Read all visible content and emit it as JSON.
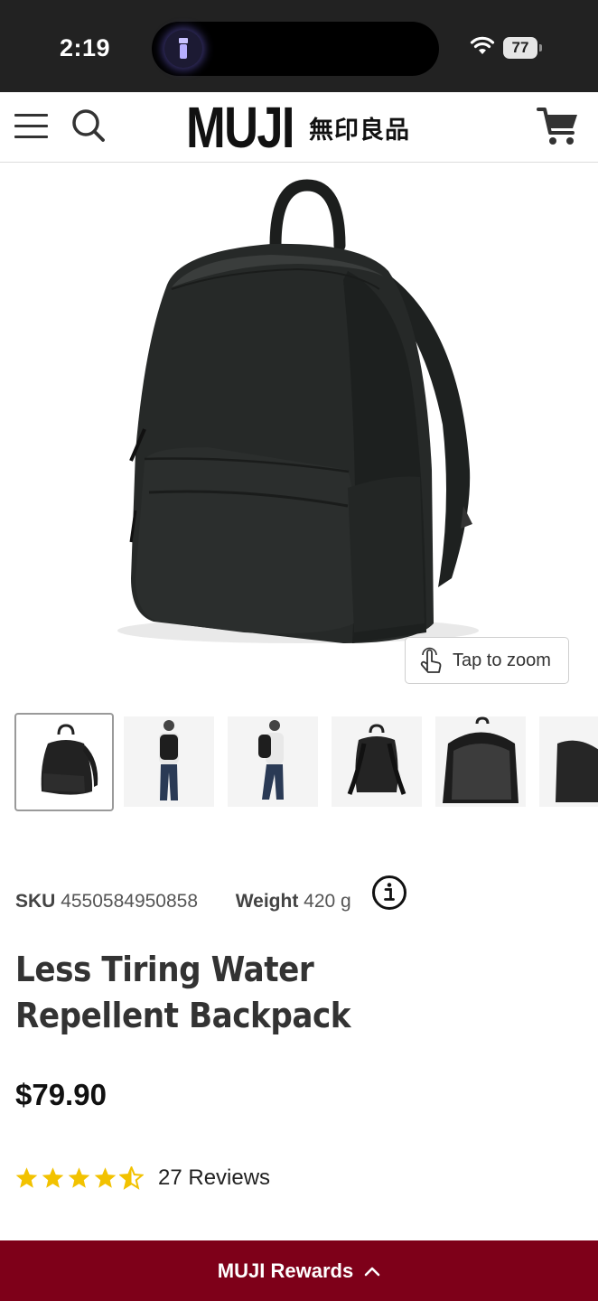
{
  "status_bar": {
    "time": "2:19",
    "battery": "77"
  },
  "header": {
    "logo_text": "MUJI",
    "logo_kanji": "無印良品"
  },
  "product": {
    "zoom_label": "Tap to zoom",
    "sku_label": "SKU",
    "sku_value": "4550584950858",
    "weight_label": "Weight",
    "weight_value": "420 g",
    "title": "Less Tiring Water Repellent Backpack",
    "price": "$79.90",
    "rating": 4.5,
    "reviews_label": "27 Reviews"
  },
  "thumbnails": [
    "backpack-front",
    "model-back",
    "model-side",
    "backpack-back",
    "backpack-open",
    "backpack-side"
  ],
  "footer": {
    "rewards_label": "MUJI Rewards"
  },
  "colors": {
    "rewards_bar": "#7e0019",
    "star": "#f2c200",
    "status_bar": "#222222"
  }
}
